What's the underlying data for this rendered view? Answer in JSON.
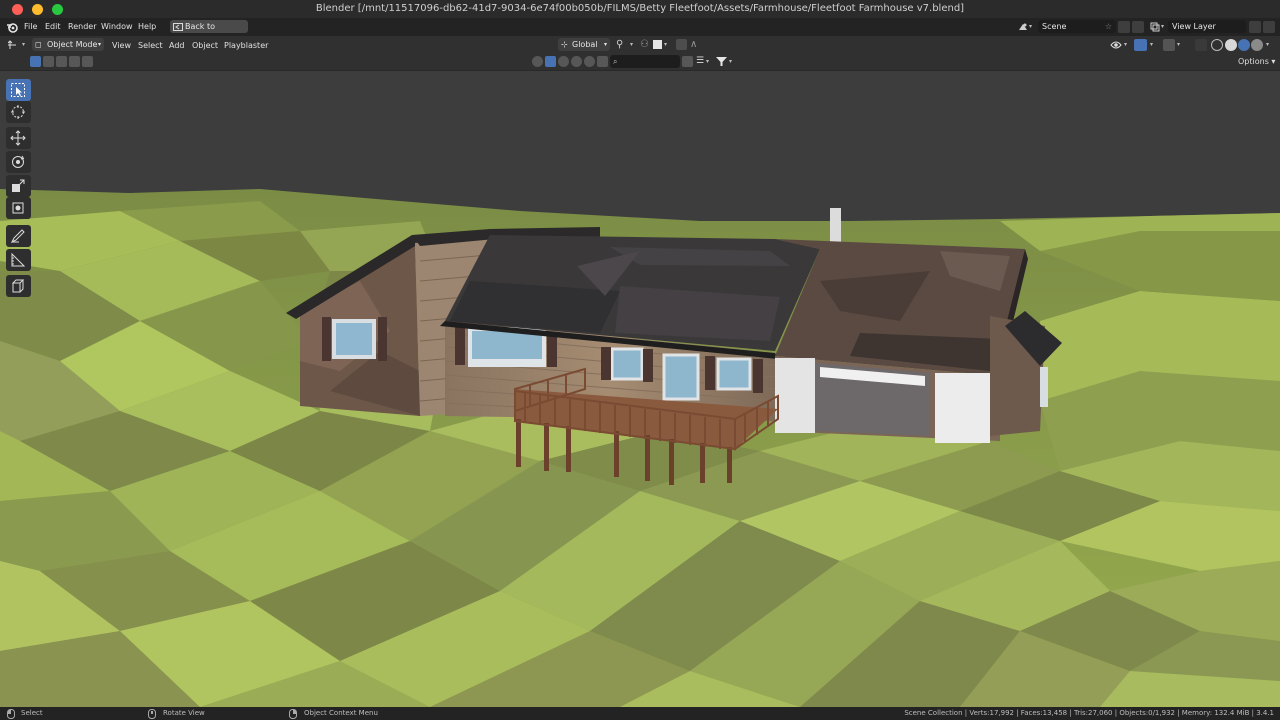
{
  "window": {
    "title": "Blender [/mnt/11517096-db62-41d7-9034-6e74f00b050b/FILMS/Betty Fleetfoot/Assets/Farmhouse/Fleetfoot Farmhouse v7.blend]"
  },
  "menubar": {
    "items": [
      "File",
      "Edit",
      "Render",
      "Window",
      "Help"
    ],
    "back_button": "Back to Previous",
    "scene_label": "Scene",
    "view_layer_label": "View Layer"
  },
  "header": {
    "mode": "Object Mode",
    "menus": [
      "View",
      "Select",
      "Add",
      "Object",
      "Playblaster"
    ],
    "orientation": "Global",
    "options_label": "Options"
  },
  "toolbar": {
    "tools": [
      "select-box",
      "cursor",
      "move",
      "rotate",
      "scale",
      "transform",
      "annotate",
      "measure",
      "add-cube"
    ],
    "active_tool": "select-box"
  },
  "statusbar": {
    "left_hint": "Select",
    "middle_hint": "Rotate View",
    "right_hint": "Object Context Menu",
    "stats": "Scene Collection | Verts:17,992 | Faces:13,458 | Tris:27,060 | Objects:0/1,932 | Memory: 132.4 MiB | 3.4.1"
  },
  "colors": {
    "accent": "#4772b3",
    "header_bg": "#303030",
    "viewport_bg": "#3d3d3d",
    "ground_green": "#8fa64a"
  }
}
